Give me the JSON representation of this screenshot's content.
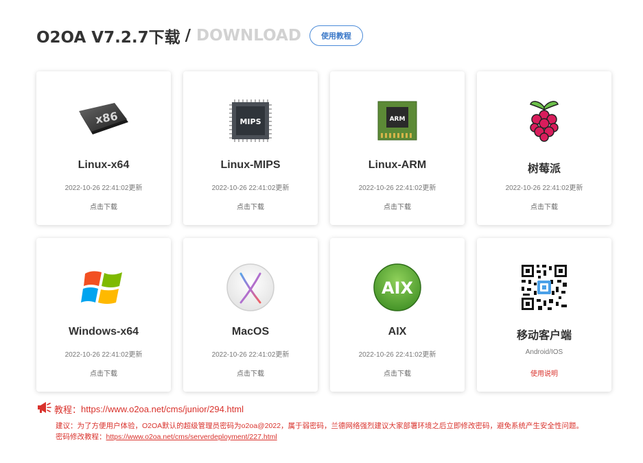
{
  "header": {
    "title": "O2OA V7.2.7下载",
    "separator": "/",
    "title_en": "DOWNLOAD",
    "tutorial_button": "使用教程"
  },
  "cards": [
    {
      "name": "Linux-x64",
      "updated": "2022-10-26 22:41:02更新",
      "action": "点击下载",
      "icon": "x86-chip-icon"
    },
    {
      "name": "Linux-MIPS",
      "updated": "2022-10-26 22:41:02更新",
      "action": "点击下载",
      "icon": "mips-chip-icon",
      "icon_text": "MIPS"
    },
    {
      "name": "Linux-ARM",
      "updated": "2022-10-26 22:41:02更新",
      "action": "点击下载",
      "icon": "arm-chip-icon",
      "icon_text": "ARM"
    },
    {
      "name": "树莓派",
      "updated": "2022-10-26 22:41:02更新",
      "action": "点击下载",
      "icon": "raspberry-pi-icon"
    },
    {
      "name": "Windows-x64",
      "updated": "2022-10-26 22:41:02更新",
      "action": "点击下载",
      "icon": "windows-logo-icon"
    },
    {
      "name": "MacOS",
      "updated": "2022-10-26 22:41:02更新",
      "action": "点击下载",
      "icon": "macos-x-icon"
    },
    {
      "name": "AIX",
      "updated": "2022-10-26 22:41:02更新",
      "action": "点击下载",
      "icon": "aix-logo-icon",
      "icon_text": "AIX"
    },
    {
      "name": "移动客户端",
      "updated": "Android/IOS",
      "action": "使用说明",
      "icon": "qr-code-icon"
    }
  ],
  "notice": {
    "label": "教程：",
    "tutorial_link": "https://www.o2oa.net/cms/junior/294.html",
    "advice": "建议：为了方便用户体验，O2OA默认的超级管理员密码为o2oa@2022，属于弱密码，兰德网络强烈建议大家部署环境之后立即修改密码，避免系统产生安全性问题。",
    "password_label": "密码修改教程：",
    "password_link": "https://www.o2oa.net/cms/serverdeployment/227.html"
  },
  "colors": {
    "accent_red": "#d9322c",
    "accent_blue": "#3a78c8",
    "title_gray": "#d2d2d2"
  }
}
